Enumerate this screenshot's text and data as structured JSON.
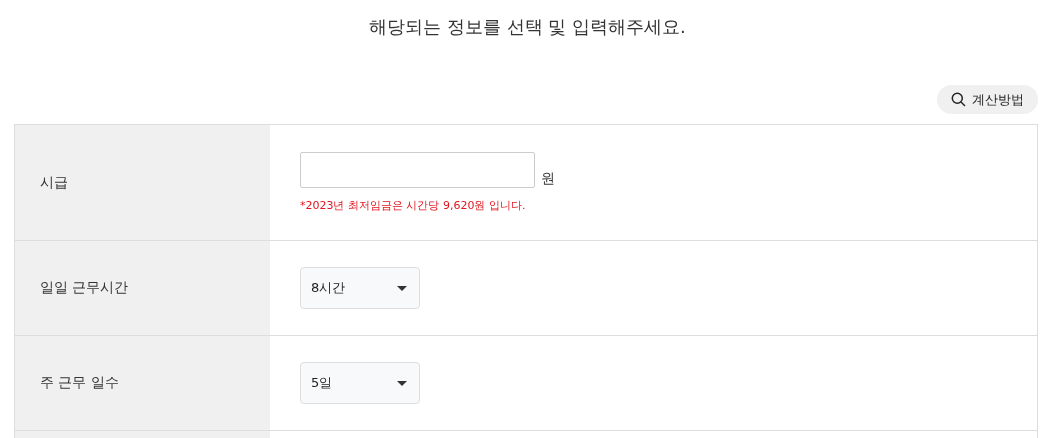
{
  "heading": "해당되는 정보를 선택 및 입력해주세요.",
  "method_button": {
    "label": "계산방법"
  },
  "rows": [
    {
      "kind": "input",
      "label": "시급",
      "unit": "원",
      "note": "*2023년 최저임금은 시간당 9,620원 입니다."
    },
    {
      "kind": "select",
      "label": "일일 근무시간",
      "value": "8시간"
    },
    {
      "kind": "select",
      "label": "주 근무 일수",
      "value": "5일"
    }
  ]
}
